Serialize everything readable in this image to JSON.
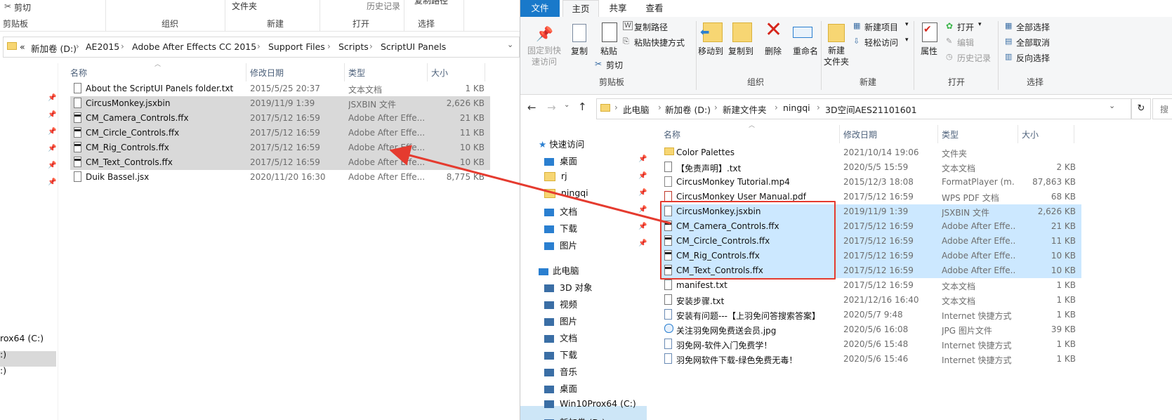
{
  "left": {
    "ribbon": {
      "cut": "剪切",
      "folder_label": "文件夹",
      "history": "历史记录",
      "partial": "复制路径",
      "groups": {
        "clipboard": "剪贴板",
        "organize": "组织",
        "new": "新建",
        "open": "打开",
        "select": "选择"
      }
    },
    "address": {
      "prefix": "«",
      "crumbs": [
        "新加卷 (D:)",
        "AE2015",
        "Adobe After Effects CC 2015",
        "Support Files",
        "Scripts",
        "ScriptUI Panels"
      ]
    },
    "columns": {
      "name": "名称",
      "date": "修改日期",
      "type": "类型",
      "size": "大小"
    },
    "files": [
      {
        "name": "About the ScriptUI Panels folder.txt",
        "date": "2015/5/25 20:37",
        "type": "文本文档",
        "size": "1 KB",
        "selected": false,
        "icon": "text-file"
      },
      {
        "name": "CircusMonkey.jsxbin",
        "date": "2019/11/9 1:39",
        "type": "JSXBIN 文件",
        "size": "2,626 KB",
        "selected": true,
        "icon": "blank-file"
      },
      {
        "name": "CM_Camera_Controls.ffx",
        "date": "2017/5/12 16:59",
        "type": "Adobe After Effe...",
        "size": "21 KB",
        "selected": true,
        "icon": "ffx-file"
      },
      {
        "name": "CM_Circle_Controls.ffx",
        "date": "2017/5/12 16:59",
        "type": "Adobe After Effe...",
        "size": "11 KB",
        "selected": true,
        "icon": "ffx-file"
      },
      {
        "name": "CM_Rig_Controls.ffx",
        "date": "2017/5/12 16:59",
        "type": "Adobe After Effe...",
        "size": "10 KB",
        "selected": true,
        "icon": "ffx-file"
      },
      {
        "name": "CM_Text_Controls.ffx",
        "date": "2017/5/12 16:59",
        "type": "Adobe After Effe...",
        "size": "10 KB",
        "selected": true,
        "icon": "ffx-file"
      },
      {
        "name": "Duik Bassel.jsx",
        "date": "2020/11/20 16:30",
        "type": "Adobe After Effe...",
        "size": "8,775 KB",
        "selected": false,
        "icon": "blank-file"
      }
    ],
    "nav_partial": [
      "rox64 (C:)",
      ":)",
      ":)"
    ]
  },
  "right": {
    "tabs": [
      "文件",
      "主页",
      "共享",
      "查看"
    ],
    "ribbon": {
      "pin": "固定到快\n速访问",
      "copy": "复制",
      "paste": "粘贴",
      "copy_path": "复制路径",
      "paste_shortcut": "粘贴快捷方式",
      "cut": "剪切",
      "move_to": "移动到",
      "copy_to": "复制到",
      "delete": "删除",
      "rename": "重命名",
      "new_folder": "新建\n文件夹",
      "new_item": "新建项目",
      "easy_access": "轻松访问",
      "properties": "属性",
      "open": "打开",
      "edit": "编辑",
      "history": "历史记录",
      "select_all": "全部选择",
      "select_none": "全部取消",
      "invert": "反向选择",
      "groups": {
        "clipboard": "剪贴板",
        "organize": "组织",
        "new": "新建",
        "open": "打开",
        "select": "选择"
      }
    },
    "address": {
      "crumbs": [
        "此电脑",
        "新加卷 (D:)",
        "新建文件夹",
        "ningqi",
        "3D空间AES21101601"
      ],
      "search_partial": "搜"
    },
    "columns": {
      "name": "名称",
      "date": "修改日期",
      "type": "类型",
      "size": "大小"
    },
    "nav": {
      "quick_access": "快速访问",
      "quick_items": [
        "桌面",
        "rj",
        "ningqi",
        "文档",
        "下载",
        "图片"
      ],
      "this_pc": "此电脑",
      "pc_items": [
        "3D 对象",
        "视频",
        "图片",
        "文档",
        "下载",
        "音乐",
        "桌面",
        "Win10Prox64 (C:)",
        "新加卷 (D:)"
      ]
    },
    "files": [
      {
        "name": "Color Palettes",
        "date": "2021/10/14 19:06",
        "type": "文件夹",
        "size": "",
        "selected": false,
        "icon": "folder"
      },
      {
        "name": "【免责声明】.txt",
        "date": "2020/5/5 15:59",
        "type": "文本文档",
        "size": "2 KB",
        "selected": false,
        "icon": "text-file"
      },
      {
        "name": "CircusMonkey Tutorial.mp4",
        "date": "2015/12/3 18:08",
        "type": "FormatPlayer (m...",
        "size": "87,863 KB",
        "selected": false,
        "icon": "video-file"
      },
      {
        "name": "CircusMonkey User Manual.pdf",
        "date": "2017/5/12 16:59",
        "type": "WPS PDF 文档",
        "size": "68 KB",
        "selected": false,
        "icon": "pdf-file"
      },
      {
        "name": "CircusMonkey.jsxbin",
        "date": "2019/11/9 1:39",
        "type": "JSXBIN 文件",
        "size": "2,626 KB",
        "selected": true,
        "icon": "blank-file"
      },
      {
        "name": "CM_Camera_Controls.ffx",
        "date": "2017/5/12 16:59",
        "type": "Adobe After Effe...",
        "size": "21 KB",
        "selected": true,
        "icon": "ffx-file"
      },
      {
        "name": "CM_Circle_Controls.ffx",
        "date": "2017/5/12 16:59",
        "type": "Adobe After Effe...",
        "size": "11 KB",
        "selected": true,
        "icon": "ffx-file"
      },
      {
        "name": "CM_Rig_Controls.ffx",
        "date": "2017/5/12 16:59",
        "type": "Adobe After Effe...",
        "size": "10 KB",
        "selected": true,
        "icon": "ffx-file"
      },
      {
        "name": "CM_Text_Controls.ffx",
        "date": "2017/5/12 16:59",
        "type": "Adobe After Effe...",
        "size": "10 KB",
        "selected": true,
        "icon": "ffx-file"
      },
      {
        "name": "manifest.txt",
        "date": "2017/5/12 16:59",
        "type": "文本文档",
        "size": "1 KB",
        "selected": false,
        "icon": "text-file"
      },
      {
        "name": "安装步骤.txt",
        "date": "2021/12/16 16:40",
        "type": "文本文档",
        "size": "1 KB",
        "selected": false,
        "icon": "text-file"
      },
      {
        "name": "安装有问题---【上羽免问答搜索答案】",
        "date": "2020/5/7 9:48",
        "type": "Internet 快捷方式",
        "size": "1 KB",
        "selected": false,
        "icon": "url-file"
      },
      {
        "name": "关注羽免网免费送会员.jpg",
        "date": "2020/5/6 16:08",
        "type": "JPG 图片文件",
        "size": "39 KB",
        "selected": false,
        "icon": "jpg-file"
      },
      {
        "name": "羽免网-软件入门免费学！",
        "date": "2020/5/6 15:48",
        "type": "Internet 快捷方式",
        "size": "1 KB",
        "selected": false,
        "icon": "url-file"
      },
      {
        "name": "羽免网软件下载-绿色免费无毒！",
        "date": "2020/5/6 15:46",
        "type": "Internet 快捷方式",
        "size": "1 KB",
        "selected": false,
        "icon": "url-file"
      }
    ]
  },
  "annotation": {
    "arrow_color": "#e53b2f",
    "box_color": "#e53b2f"
  }
}
